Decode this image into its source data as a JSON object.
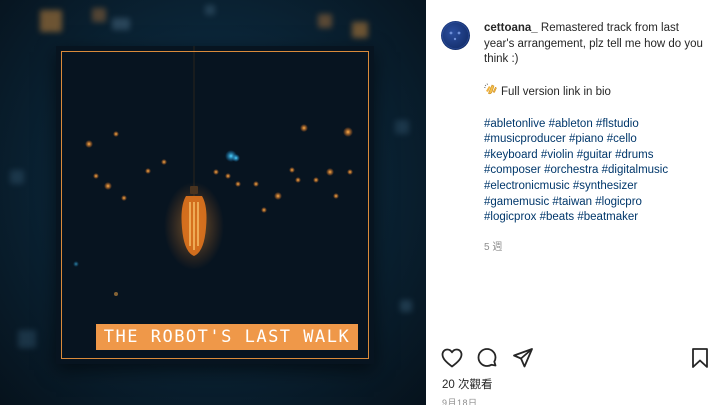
{
  "post": {
    "username": "cettoana_",
    "caption_line1": "Remastered track from last year's arrangement, plz tell me how do you think :)",
    "caption_line2_icon": "clapping-hands-icon",
    "caption_line2": "Full version link in bio",
    "hashtags": [
      "#abletonlive",
      "#ableton",
      "#flstudio",
      "#musicproducer",
      "#piano",
      "#cello",
      "#keyboard",
      "#violin",
      "#guitar",
      "#drums",
      "#composer",
      "#orchestra",
      "#digitalmusic",
      "#electronicmusic",
      "#synthesizer",
      "#gamemusic",
      "#taiwan",
      "#logicpro",
      "#logicprox",
      "#beats",
      "#beatmaker"
    ],
    "age": "5 週",
    "views": "20 次觀看",
    "date": "9月18日"
  },
  "media": {
    "cover_title": "THE ROBOT'S LAST WALK",
    "accent_color": "#ef9849"
  },
  "actions": {
    "like_icon": "heart-icon",
    "comment_icon": "comment-icon",
    "share_icon": "share-icon",
    "save_icon": "bookmark-icon"
  }
}
